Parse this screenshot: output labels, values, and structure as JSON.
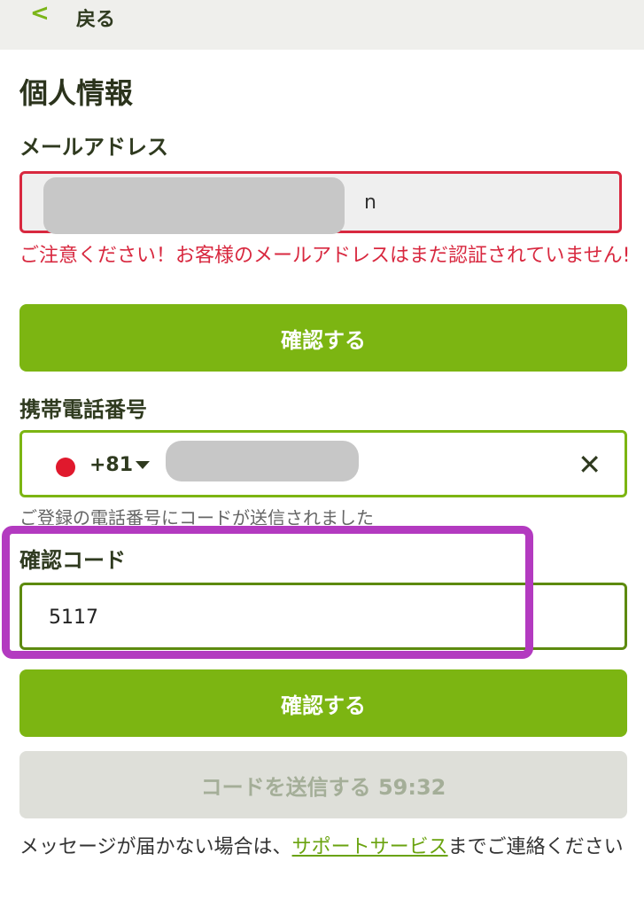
{
  "header": {
    "back_icon": "chevron-left-icon",
    "back_label": "戻る"
  },
  "page": {
    "title": "個人情報"
  },
  "email": {
    "label": "メールアドレス",
    "value_visible_tail": "n",
    "warning": "ご注意ください！お客様のメールアドレスはまだ認証されていません!",
    "confirm_button": "確認する"
  },
  "phone": {
    "label": "携帯電話番号",
    "country_code": "+81",
    "clear_icon": "close-icon",
    "sent_note": "ご登録の電話番号にコードが送信されました"
  },
  "verification": {
    "label": "確認コード",
    "value": "5117",
    "confirm_button": "確認する",
    "resend_button": "コードを送信する 59:32"
  },
  "help": {
    "text_before": "メッセージが届かない場合は、",
    "link": "サポートサービス",
    "text_after": "までご連絡ください"
  },
  "colors": {
    "accent_green": "#7cb512",
    "error_red": "#d8283f",
    "highlight_purple": "#b33ac0"
  }
}
